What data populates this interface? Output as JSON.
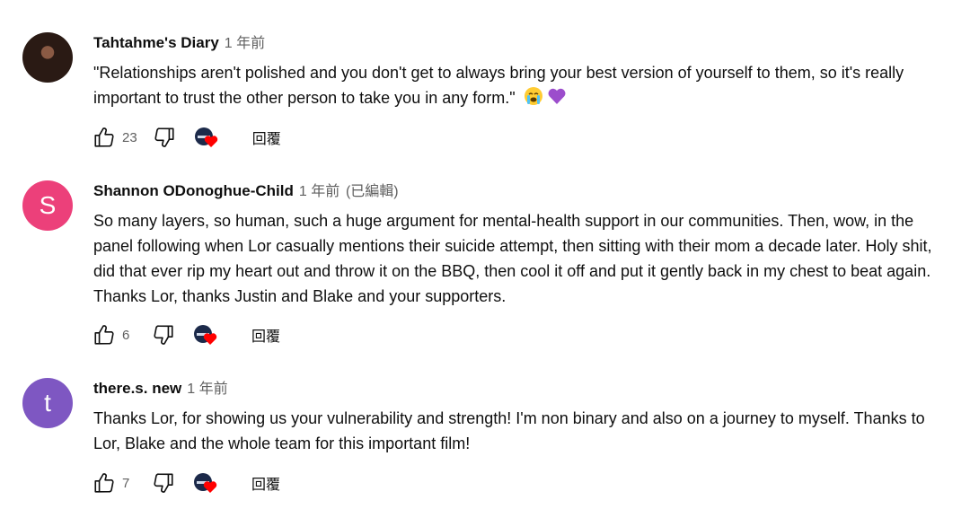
{
  "comments": [
    {
      "author": "Tahtahme's Diary",
      "time": "1 年前",
      "edited": "",
      "text": "\"Relationships aren't polished and you don't get to always bring your best version of yourself to them, so it's really important to trust the other person to take you in any form.\"",
      "avatar_letter": "",
      "avatar_color": "",
      "likes": "23",
      "reply_label": "回覆"
    },
    {
      "author": "Shannon ODonoghue-Child",
      "time": "1 年前",
      "edited": "(已編輯)",
      "text": "So many layers, so human, such a huge argument for mental-health support in our communities. Then, wow, in the panel following when Lor casually mentions their suicide attempt, then sitting with their mom a decade later. Holy shit, did that ever rip my heart out and throw it on the BBQ, then cool it off and put it gently back in my chest to beat again. Thanks Lor, thanks Justin and Blake and your supporters.",
      "avatar_letter": "S",
      "avatar_color": "#ec407a",
      "likes": "6",
      "reply_label": "回覆"
    },
    {
      "author": "there.s. new",
      "time": "1 年前",
      "edited": "",
      "text": "Thanks Lor, for showing us your vulnerability and strength!  I'm non binary and also on a journey to myself. Thanks to Lor, Blake and the whole team for this important film!",
      "avatar_letter": "t",
      "avatar_color": "#7e57c2",
      "likes": "7",
      "reply_label": "回覆"
    }
  ],
  "icons": [
    "thumbs-up-icon",
    "thumbs-down-icon",
    "creator-heart-icon",
    "crying-emoji-icon",
    "purple-heart-emoji-icon"
  ],
  "colors": {
    "heart_red": "#ff0000",
    "muted": "#606060",
    "text": "#0f0f0f"
  }
}
